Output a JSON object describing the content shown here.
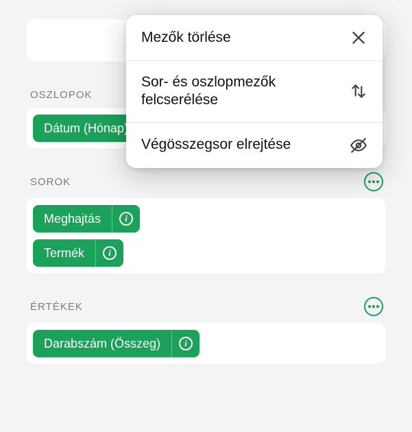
{
  "sections": {
    "columns": {
      "title": "OSZLOPOK",
      "pills": [
        "Dátum (Hónap)"
      ]
    },
    "rows": {
      "title": "SOROK",
      "pills": [
        "Meghajtás",
        "Termék"
      ]
    },
    "values": {
      "title": "ÉRTÉKEK",
      "pills": [
        "Darabszám (Összeg)"
      ]
    }
  },
  "popover": {
    "clear": "Mezők törlése",
    "swap": "Sor- és oszlopmezők felcserélése",
    "hideGrand": "Végösszegsor elrejtése"
  }
}
